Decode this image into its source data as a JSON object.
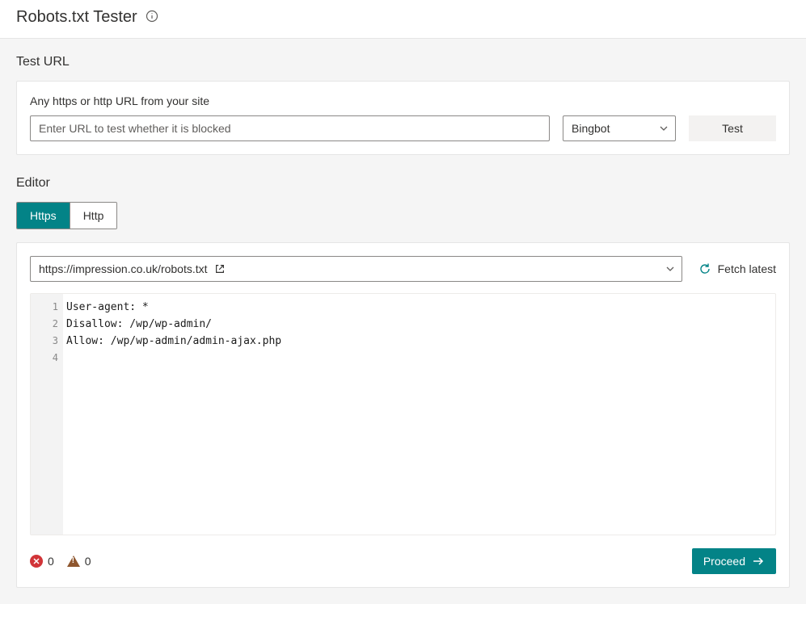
{
  "header": {
    "title": "Robots.txt Tester"
  },
  "test_url": {
    "section_title": "Test URL",
    "hint": "Any https or http URL from your site",
    "input_placeholder": "Enter URL to test whether it is blocked",
    "bot_select": "Bingbot",
    "test_button": "Test"
  },
  "editor": {
    "section_title": "Editor",
    "tabs": {
      "https": "Https",
      "http": "Http",
      "active": "https"
    },
    "file_select": "https://impression.co.uk/robots.txt",
    "fetch_label": "Fetch latest",
    "lines": [
      "User-agent: *",
      "Disallow: /wp/wp-admin/",
      "Allow: /wp/wp-admin/admin-ajax.php",
      ""
    ],
    "errors_count": "0",
    "warnings_count": "0",
    "proceed_label": "Proceed"
  }
}
